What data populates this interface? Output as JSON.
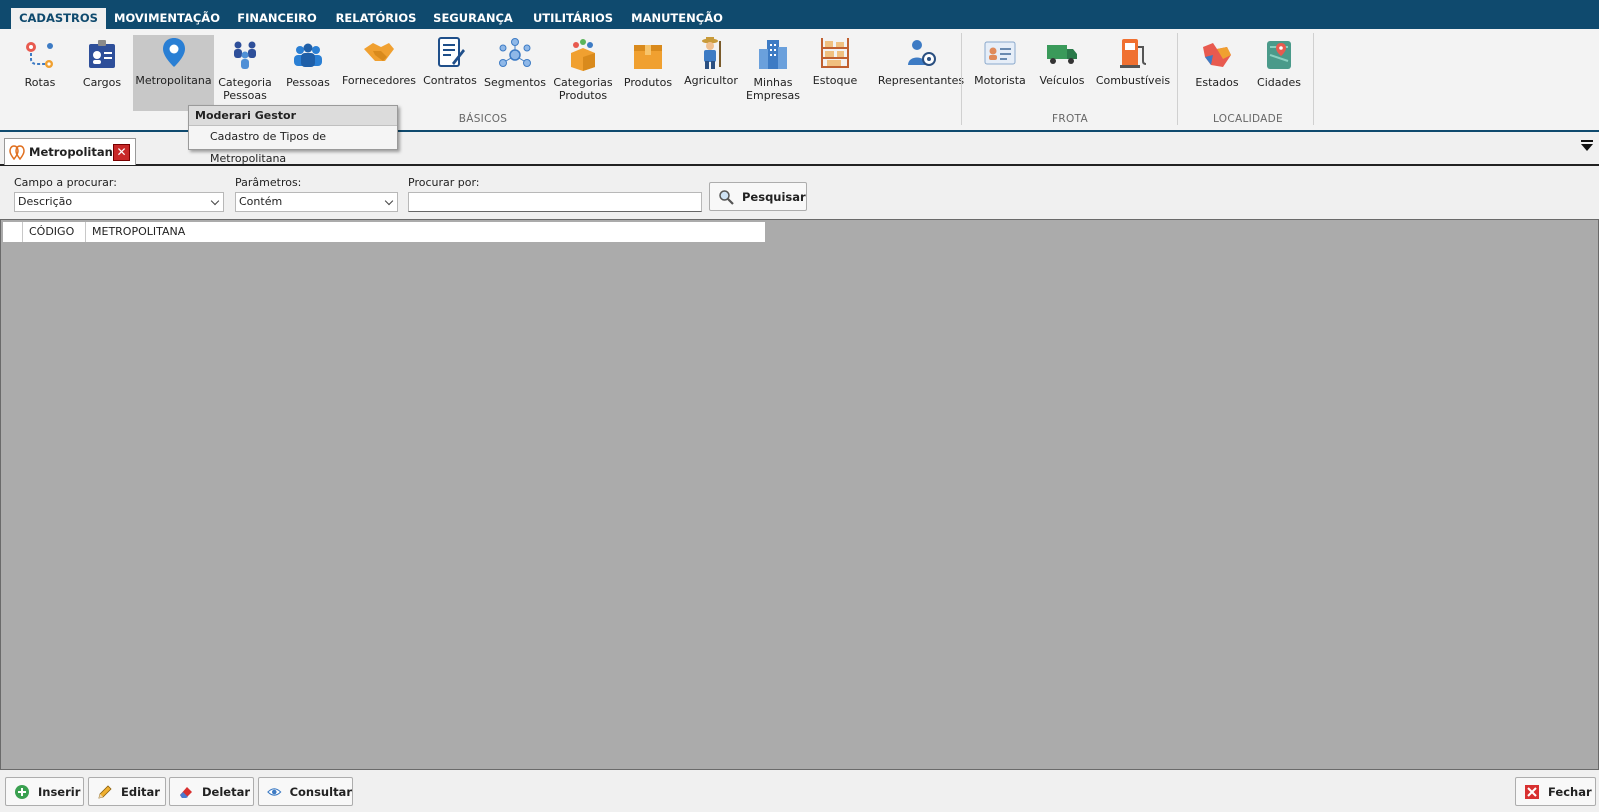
{
  "menu": {
    "tabs": [
      "CADASTROS",
      "MOVIMENTAÇÃO",
      "FINANCEIRO",
      "RELATÓRIOS",
      "SEGURANÇA",
      "UTILITÁRIOS",
      "MANUTENÇÃO"
    ],
    "active_tab": "CADASTROS"
  },
  "ribbon": {
    "buttons": {
      "rotas": "Rotas",
      "cargos": "Cargos",
      "metropolitana": "Metropolitana",
      "categoria_pessoas": "Categoria\nPessoas",
      "pessoas": "Pessoas",
      "fornecedores": "Fornecedores",
      "contratos": "Contratos",
      "segmentos": "Segmentos",
      "categorias_produtos": "Categorias\nProdutos",
      "produtos": "Produtos",
      "agricultor": "Agricultor",
      "minhas_empresas": "Minhas\nEmpresas",
      "estoque": "Estoque",
      "representantes": "Representantes",
      "motorista": "Motorista",
      "veiculos": "Veículos",
      "combustiveis": "Combustíveis",
      "estados": "Estados",
      "cidades": "Cidades"
    },
    "groups": {
      "basicos": "BÁSICOS",
      "frota": "FROTA",
      "localidade": "LOCALIDADE"
    }
  },
  "popup": {
    "header": "Moderari Gestor",
    "item": "Cadastro de Tipos de Metropolitana"
  },
  "document_tab": {
    "title": "Metropolitana",
    "close_glyph": "✕"
  },
  "search": {
    "campo_label": "Campo a procurar:",
    "campo_value": "Descrição",
    "parametros_label": "Parâmetros:",
    "parametros_value": "Contém",
    "procurar_label": "Procurar por:",
    "procurar_value": "",
    "pesquisar_label": "Pesquisar"
  },
  "grid": {
    "columns": [
      "CÓDIGO",
      "METROPOLITANA"
    ],
    "rows": []
  },
  "bottom": {
    "inserir": "Inserir",
    "editar": "Editar",
    "deletar": "Deletar",
    "consultar": "Consultar",
    "fechar": "Fechar"
  },
  "colors": {
    "menubar": "#0f4a6e",
    "grid_bg": "#ababab",
    "close_red": "#c82828"
  }
}
